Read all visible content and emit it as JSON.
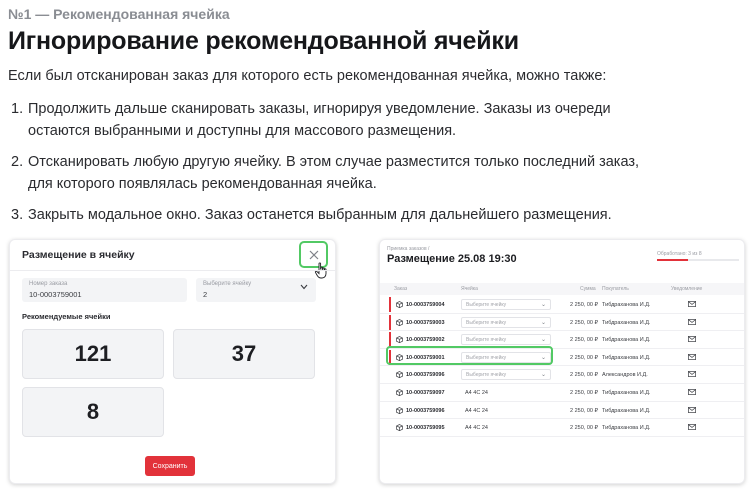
{
  "header": {
    "eyebrow": "№1 — Рекомендованная ячейка",
    "title": "Игнорирование рекомендованной ячейки",
    "intro": "Если был отсканирован заказ для которого есть рекомендованная ячейка, можно также:"
  },
  "steps": [
    {
      "num": "1.",
      "lines": [
        "Продолжить дальше сканировать заказы, игнорируя уведомление. Заказы из очереди",
        "остаются выбранными и доступны для массового размещения."
      ]
    },
    {
      "num": "2.",
      "lines": [
        "Отсканировать любую другую ячейку. В этом случае разместится только последний заказ,",
        "для которого появлялась рекомендованная ячейка."
      ]
    },
    {
      "num": "3.",
      "lines": [
        "Закрыть модальное окно. Заказ останется выбранным для дальнейшего размещения."
      ]
    }
  ],
  "modal": {
    "title": "Размещение в ячейку",
    "close_icon": "close-icon",
    "order_field": {
      "label": "Номер заказа",
      "value": "10-0003759001"
    },
    "cell_field": {
      "label": "Выберите ячейку",
      "value": "2"
    },
    "recommended_title": "Рекомендуемые ячейки",
    "recommended_cells": [
      "121",
      "37",
      "8"
    ],
    "save_label": "Сохранить",
    "accent_color": "#e2323a",
    "highlight_color": "#52c964"
  },
  "panel": {
    "breadcrumb": "Приемка заказов /",
    "title": "Размещение 25.08 19:30",
    "progress_text": "Обработано: 3 из 8",
    "progress": 0.375,
    "columns": [
      "Заказ",
      "Ячейка",
      "Сумма",
      "Покупатель",
      "Уведомление"
    ],
    "rows": [
      {
        "order": "10-0003759004",
        "cell": "Выберите ячейку",
        "cell_is_select": true,
        "sum": "2 250, 00 ₽",
        "buyer": "Тибдраханова И.Д.",
        "flag": true
      },
      {
        "order": "10-0003759003",
        "cell": "Выберите ячейку",
        "cell_is_select": true,
        "sum": "2 250, 00 ₽",
        "buyer": "Тибдраханова И.Д.",
        "flag": true
      },
      {
        "order": "10-0003759002",
        "cell": "Выберите ячейку",
        "cell_is_select": true,
        "sum": "2 250, 00 ₽",
        "buyer": "Тибдраханова И.Д.",
        "flag": true
      },
      {
        "order": "10-0003759001",
        "cell": "Выберите ячейку",
        "cell_is_select": true,
        "sum": "2 250, 00 ₽",
        "buyer": "Тибдраханова И.Д.",
        "flag": true
      },
      {
        "order": "10-0003759096",
        "cell": "Выберите ячейку",
        "cell_is_select": true,
        "sum": "2 250, 00 ₽",
        "buyer": "Александров И.Д.",
        "flag": false
      },
      {
        "order": "10-0003759097",
        "cell": "A4 4С 24",
        "cell_is_select": false,
        "sum": "2 250, 00 ₽",
        "buyer": "Тибдраханова И.Д.",
        "flag": false
      },
      {
        "order": "10-0003759096",
        "cell": "A4 4С 24",
        "cell_is_select": false,
        "sum": "2 250, 00 ₽",
        "buyer": "Тибдраханова И.Д.",
        "flag": false
      },
      {
        "order": "10-0003759095",
        "cell": "A4 4С 24",
        "cell_is_select": false,
        "sum": "2 250, 00 ₽",
        "buyer": "Тибдраханова И.Д.",
        "flag": false
      }
    ]
  }
}
